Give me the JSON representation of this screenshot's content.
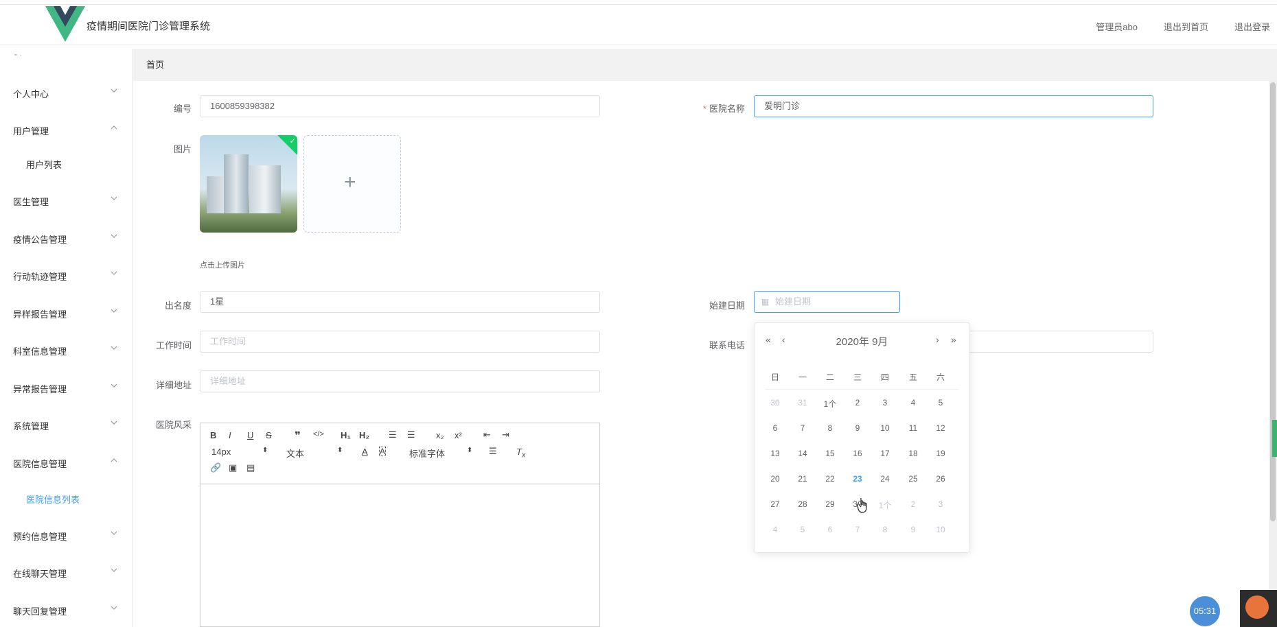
{
  "header": {
    "title": "疫情期间医院门诊管理系统",
    "links": [
      "管理员abo",
      "退出到首页",
      "退出登录"
    ]
  },
  "sidebar": {
    "items": [
      {
        "label": "个人中心",
        "expanded": false
      },
      {
        "label": "用户管理",
        "expanded": true
      },
      {
        "label": "用户列表",
        "sub": true
      },
      {
        "label": "医生管理",
        "expanded": false
      },
      {
        "label": "疫情公告管理",
        "expanded": false
      },
      {
        "label": "行动轨迹管理",
        "expanded": false
      },
      {
        "label": "异样报告管理",
        "expanded": false
      },
      {
        "label": "科室信息管理",
        "expanded": false
      },
      {
        "label": "异常报告管理",
        "expanded": false
      },
      {
        "label": "系统管理",
        "expanded": false
      },
      {
        "label": "医院信息管理",
        "expanded": true
      },
      {
        "label": "医院信息列表",
        "sub": true,
        "active": true
      },
      {
        "label": "预约信息管理",
        "expanded": false
      },
      {
        "label": "在线聊天管理",
        "expanded": false
      },
      {
        "label": "聊天回复管理",
        "expanded": false
      }
    ]
  },
  "breadcrumb": "首页",
  "form": {
    "code_label": "编号",
    "code_value": "1600859398382",
    "name_label": "医院名称",
    "name_value": "爱明门诊",
    "image_label": "图片",
    "upload_hint": "点击上传图片",
    "fame_label": "出名度",
    "fame_value": "1星",
    "date_label": "始建日期",
    "date_placeholder": "始建日期",
    "worktime_label": "工作时间",
    "worktime_placeholder": "工作时间",
    "phone_label": "联系电话",
    "address_label": "详细地址",
    "address_placeholder": "详细地址",
    "style_label": "医院风采"
  },
  "editor": {
    "font_size": "14px",
    "text_type": "文本",
    "font_family": "标准字体"
  },
  "datepicker": {
    "title": "2020年  9月",
    "weekdays": [
      "日",
      "一",
      "二",
      "三",
      "四",
      "五",
      "六"
    ],
    "weeks": [
      [
        "30",
        "31",
        "1个",
        "2",
        "3",
        "4",
        "5"
      ],
      [
        "6",
        "7",
        "8",
        "9",
        "10",
        "11",
        "12"
      ],
      [
        "13",
        "14",
        "15",
        "16",
        "17",
        "18",
        "19"
      ],
      [
        "20",
        "21",
        "22",
        "23",
        "24",
        "25",
        "26"
      ],
      [
        "27",
        "28",
        "29",
        "30",
        "1个",
        "2",
        "3"
      ],
      [
        "4",
        "5",
        "6",
        "7",
        "8",
        "9",
        "10"
      ]
    ],
    "today": "23"
  },
  "timer": "05:31",
  "colors": {
    "accent": "#409eff",
    "logo_dark": "#35495e",
    "logo_light": "#41b883"
  }
}
